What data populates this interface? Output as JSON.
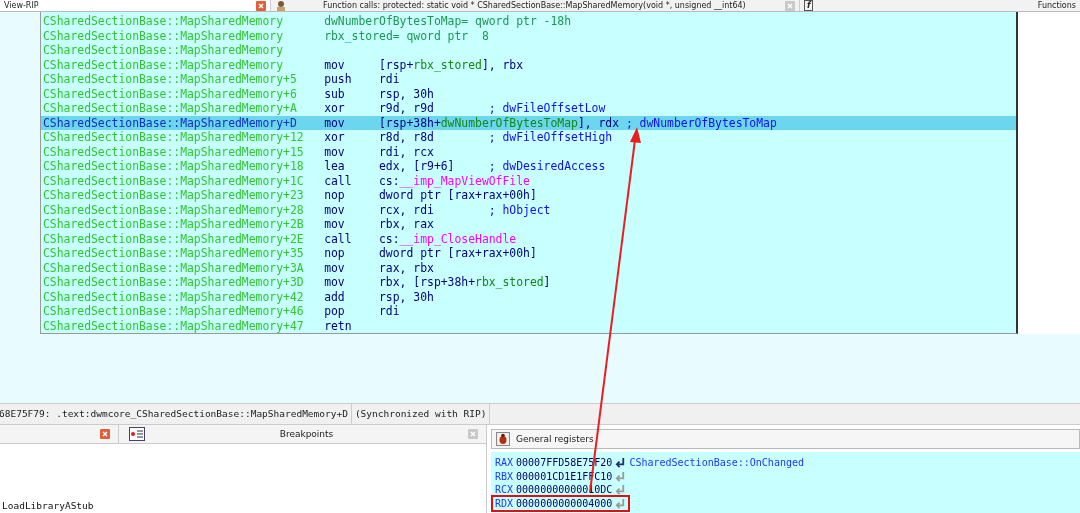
{
  "tabs": [
    {
      "title": "View-RIP",
      "selected": true
    },
    {
      "title": "Function calls: protected: static void * CSharedSectionBase::MapSharedMemory(void *, unsigned __int64)",
      "selected": false
    },
    {
      "title": "Functions",
      "selected": false
    }
  ],
  "function_icon": "f",
  "listing": [
    {
      "kind": "stackvar",
      "address": "CSharedSectionBase::MapSharedMemory",
      "definition": "dwNumberOfBytesToMap= qword ptr -18h",
      "selected": false
    },
    {
      "kind": "stackvar",
      "address": "CSharedSectionBase::MapSharedMemory",
      "definition": "rbx_stored= qword ptr  8",
      "selected": false
    },
    {
      "kind": "blank",
      "address": "CSharedSectionBase::MapSharedMemory",
      "selected": false
    },
    {
      "kind": "instr",
      "address": "CSharedSectionBase::MapSharedMemory",
      "mnemonic": "mov",
      "operands": [
        {
          "text": "[rsp+",
          "kind": "plain"
        },
        {
          "text": "rbx_stored",
          "kind": "name"
        },
        {
          "text": "], rbx",
          "kind": "plain"
        }
      ],
      "selected": false
    },
    {
      "kind": "instr",
      "address": "CSharedSectionBase::MapSharedMemory+5",
      "mnemonic": "push",
      "operands": [
        {
          "text": "rdi",
          "kind": "plain"
        }
      ],
      "selected": false
    },
    {
      "kind": "instr",
      "address": "CSharedSectionBase::MapSharedMemory+6",
      "mnemonic": "sub",
      "operands": [
        {
          "text": "rsp, 30h",
          "kind": "plain"
        }
      ],
      "selected": false
    },
    {
      "kind": "instr",
      "address": "CSharedSectionBase::MapSharedMemory+A",
      "mnemonic": "xor",
      "operands": [
        {
          "text": "r9d, r9d",
          "kind": "plain"
        }
      ],
      "comment": "; dwFileOffsetLow",
      "selected": false
    },
    {
      "kind": "instr",
      "address": "CSharedSectionBase::MapSharedMemory+D",
      "mnemonic": "mov",
      "operands": [
        {
          "text": "[rsp+38h+",
          "kind": "plain"
        },
        {
          "text": "dwNumberOfBytesToMap",
          "kind": "name"
        },
        {
          "text": "], rdx",
          "kind": "plain"
        }
      ],
      "comment": "; dwNumberOfBytesToMap",
      "selected": true
    },
    {
      "kind": "instr",
      "address": "CSharedSectionBase::MapSharedMemory+12",
      "mnemonic": "xor",
      "operands": [
        {
          "text": "r8d, r8d",
          "kind": "plain"
        }
      ],
      "comment": "; dwFileOffsetHigh",
      "selected": false
    },
    {
      "kind": "instr",
      "address": "CSharedSectionBase::MapSharedMemory+15",
      "mnemonic": "mov",
      "operands": [
        {
          "text": "rdi, rcx",
          "kind": "plain"
        }
      ],
      "selected": false
    },
    {
      "kind": "instr",
      "address": "CSharedSectionBase::MapSharedMemory+18",
      "mnemonic": "lea",
      "operands": [
        {
          "text": "edx, [r9+6]",
          "kind": "plain"
        }
      ],
      "comment": "; dwDesiredAccess",
      "selected": false
    },
    {
      "kind": "instr",
      "address": "CSharedSectionBase::MapSharedMemory+1C",
      "mnemonic": "call",
      "operands": [
        {
          "text": "cs:",
          "kind": "plain"
        },
        {
          "text": "__imp_MapViewOfFile",
          "kind": "import"
        }
      ],
      "selected": false
    },
    {
      "kind": "instr",
      "address": "CSharedSectionBase::MapSharedMemory+23",
      "mnemonic": "nop",
      "operands": [
        {
          "text": "dword ptr [rax+rax+00h]",
          "kind": "plain"
        }
      ],
      "selected": false
    },
    {
      "kind": "instr",
      "address": "CSharedSectionBase::MapSharedMemory+28",
      "mnemonic": "mov",
      "operands": [
        {
          "text": "rcx, rdi",
          "kind": "plain"
        }
      ],
      "comment": "; hObject",
      "selected": false
    },
    {
      "kind": "instr",
      "address": "CSharedSectionBase::MapSharedMemory+2B",
      "mnemonic": "mov",
      "operands": [
        {
          "text": "rbx, rax",
          "kind": "plain"
        }
      ],
      "selected": false
    },
    {
      "kind": "instr",
      "address": "CSharedSectionBase::MapSharedMemory+2E",
      "mnemonic": "call",
      "operands": [
        {
          "text": "cs:",
          "kind": "plain"
        },
        {
          "text": "__imp_CloseHandle",
          "kind": "import"
        }
      ],
      "selected": false
    },
    {
      "kind": "instr",
      "address": "CSharedSectionBase::MapSharedMemory+35",
      "mnemonic": "nop",
      "operands": [
        {
          "text": "dword ptr [rax+rax+00h]",
          "kind": "plain"
        }
      ],
      "selected": false
    },
    {
      "kind": "instr",
      "address": "CSharedSectionBase::MapSharedMemory+3A",
      "mnemonic": "mov",
      "operands": [
        {
          "text": "rax, rbx",
          "kind": "plain"
        }
      ],
      "selected": false
    },
    {
      "kind": "instr",
      "address": "CSharedSectionBase::MapSharedMemory+3D",
      "mnemonic": "mov",
      "operands": [
        {
          "text": "rbx, [rsp+38h+",
          "kind": "plain"
        },
        {
          "text": "rbx_stored",
          "kind": "name"
        },
        {
          "text": "]",
          "kind": "plain"
        }
      ],
      "selected": false
    },
    {
      "kind": "instr",
      "address": "CSharedSectionBase::MapSharedMemory+42",
      "mnemonic": "add",
      "operands": [
        {
          "text": "rsp, 30h",
          "kind": "plain"
        }
      ],
      "selected": false
    },
    {
      "kind": "instr",
      "address": "CSharedSectionBase::MapSharedMemory+46",
      "mnemonic": "pop",
      "operands": [
        {
          "text": "rdi",
          "kind": "plain"
        }
      ],
      "selected": false
    },
    {
      "kind": "instr",
      "address": "CSharedSectionBase::MapSharedMemory+47",
      "mnemonic": "retn",
      "selected": false
    }
  ],
  "status": {
    "location": "68E75F79: .text:dwmcore_CSharedSectionBase::MapSharedMemory+D",
    "sync": "(Synchronized with RIP)"
  },
  "breakpoints": {
    "title": "Breakpoints",
    "items": [
      "LoadLibraryAStub"
    ]
  },
  "registers": {
    "title": "General registers",
    "rows": [
      {
        "name": "RAX",
        "value": "00007FFD58E75F20",
        "points_to": "CSharedSectionBase::OnChanged",
        "highlighted": false
      },
      {
        "name": "RBX",
        "value": "000001CD1E1FFC10",
        "highlighted": false
      },
      {
        "name": "RCX",
        "value": "00000000000010DC",
        "highlighted": false
      },
      {
        "name": "RDX",
        "value": "0000000000004000",
        "highlighted": true
      }
    ]
  }
}
